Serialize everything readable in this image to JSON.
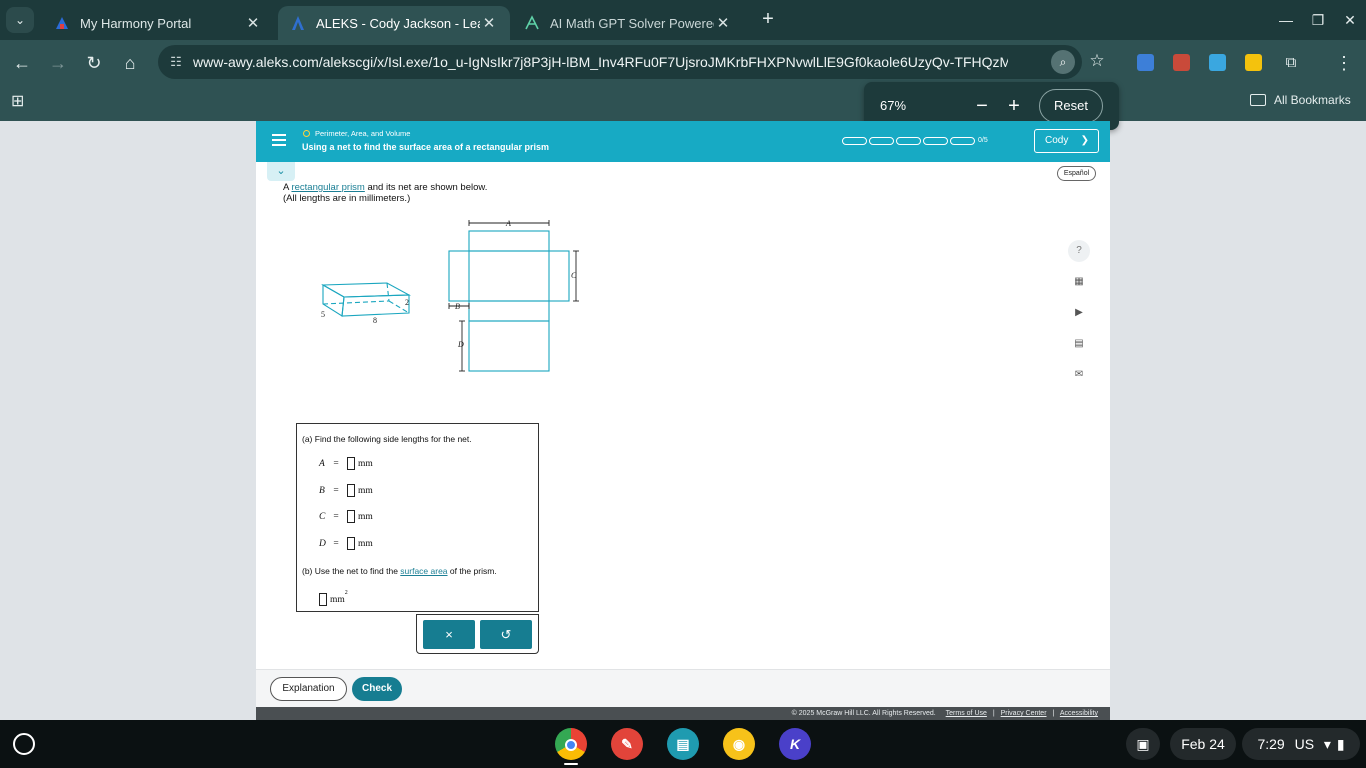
{
  "browser": {
    "tabs": [
      {
        "title": "My Harmony Portal",
        "icon": "harmony-icon"
      },
      {
        "title": "ALEKS - Cody Jackson - Learn",
        "icon": "aleks-icon"
      },
      {
        "title": "AI Math GPT Solver Powered by",
        "icon": "mathgpt-icon"
      }
    ],
    "url": "www-awy.aleks.com/alekscgi/x/Isl.exe/1o_u-IgNsIkr7j8P3jH-lBM_Inv4RFu0F7UjsroJMKrbFHXPNvwlLlE9Gf0kaole6UzyQv-TFHQzMCZ...",
    "all_bookmarks": "All Bookmarks",
    "zoom": {
      "level": "67%",
      "reset": "Reset"
    }
  },
  "aleks": {
    "topic": "Perimeter, Area, and Volume",
    "lesson": "Using a net to find the surface area of a rectangular prism",
    "progress_text": "0/5",
    "progress": {
      "completed": 0,
      "total": 5
    },
    "user": "Cody",
    "espanol": "Español",
    "question": {
      "line1_prefix": "A ",
      "line1_link": "rectangular prism",
      "line1_suffix": " and its net are shown below.",
      "line2": "(All lengths are in millimeters.)"
    },
    "prism_labels": {
      "height": "2",
      "depth": "5",
      "length": "8"
    },
    "net_labels": {
      "a": "A",
      "b": "B",
      "c": "C",
      "d": "D"
    },
    "part_a": "(a) Find the following side lengths for the net.",
    "rows": [
      {
        "var": "A",
        "eq": "=",
        "unit": "mm"
      },
      {
        "var": "B",
        "eq": "=",
        "unit": "mm"
      },
      {
        "var": "C",
        "eq": "=",
        "unit": "mm"
      },
      {
        "var": "D",
        "eq": "=",
        "unit": "mm"
      }
    ],
    "part_b_prefix": "(b) Use the net to find the ",
    "part_b_link": "surface area",
    "part_b_suffix": " of the prism.",
    "sa_unit": "mm",
    "sa_exp": "2",
    "keypad": {
      "clear": "×",
      "undo": "↺"
    },
    "explanation": "Explanation",
    "check": "Check",
    "copyright": "© 2025 McGraw Hill LLC. All Rights Reserved.",
    "footer_links": [
      "Terms of Use",
      "Privacy Center",
      "Accessibility"
    ],
    "tools": [
      "help-icon",
      "calculator-icon",
      "video-icon",
      "ebook-icon",
      "mail-icon"
    ]
  },
  "taskbar": {
    "date": "Feb 24",
    "time": "7:29",
    "locale": "US",
    "apps": [
      "chrome-icon",
      "canvas-paint-icon",
      "news-reader-icon",
      "keep-icon",
      "kami-icon"
    ],
    "kami_letter": "K"
  }
}
